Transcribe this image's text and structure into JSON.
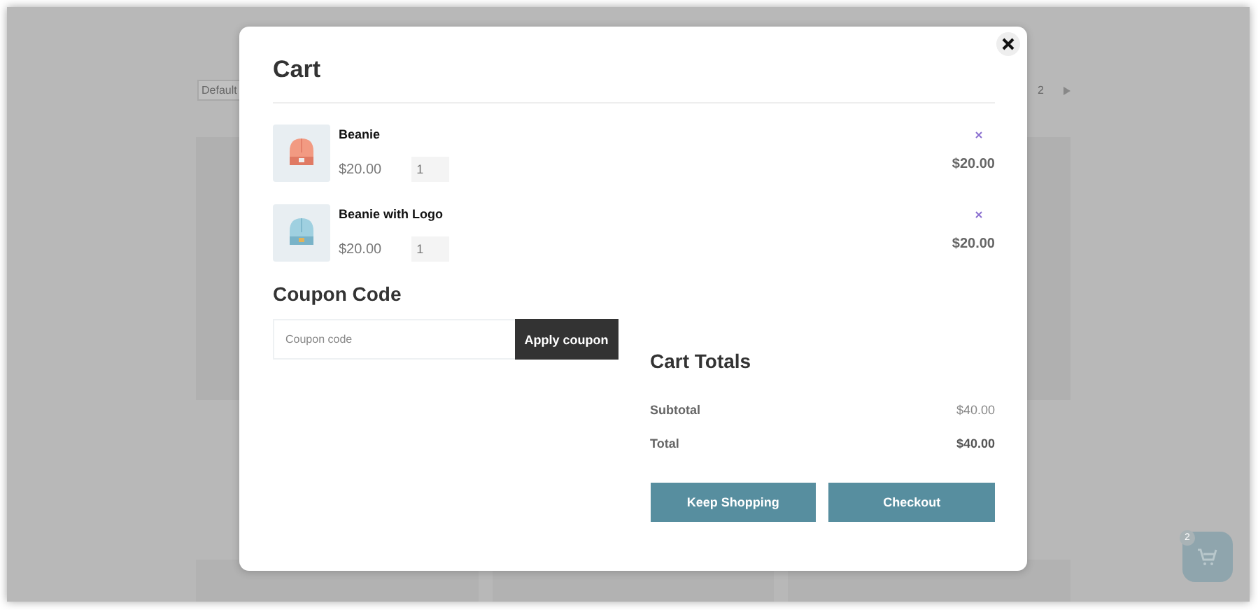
{
  "background": {
    "sort_select": "Default",
    "pagination": [
      {
        "label": "2"
      }
    ],
    "cart_button": {
      "badge": "2"
    }
  },
  "modal": {
    "title": "Cart",
    "items": [
      {
        "name": "Beanie",
        "price": "$20.00",
        "quantity": "1",
        "total": "$20.00"
      },
      {
        "name": "Beanie with Logo",
        "price": "$20.00",
        "quantity": "1",
        "total": "$20.00"
      }
    ],
    "coupon": {
      "title": "Coupon Code",
      "placeholder": "Coupon code",
      "button": "Apply coupon"
    },
    "totals": {
      "title": "Cart Totals",
      "rows": [
        {
          "label": "Subtotal",
          "value": "$40.00",
          "kind": "subtotal"
        },
        {
          "label": "Total",
          "value": "$40.00",
          "kind": "total"
        }
      ]
    },
    "buttons": [
      "Keep Shopping",
      "Checkout"
    ]
  }
}
